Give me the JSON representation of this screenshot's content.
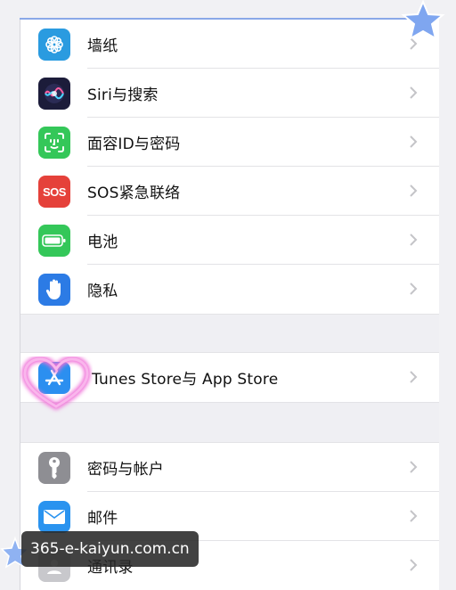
{
  "settings": {
    "group1": [
      {
        "label": "墙纸",
        "icon": "wallpaper-icon",
        "color": "#2a9be0"
      },
      {
        "label": "Siri与搜索",
        "icon": "siri-icon",
        "color": "#1c1c3a"
      },
      {
        "label": "面容ID与密码",
        "icon": "face-id-icon",
        "color": "#34c759"
      },
      {
        "label": "SOS紧急联络",
        "icon": "sos-icon",
        "color": "#e5413a"
      },
      {
        "label": "电池",
        "icon": "battery-icon",
        "color": "#34c759"
      },
      {
        "label": "隐私",
        "icon": "privacy-hand-icon",
        "color": "#2c7be5"
      }
    ],
    "group2": [
      {
        "label": "Tunes Store与 App Store",
        "icon": "app-store-icon",
        "color": "#2b8ff0"
      }
    ],
    "group3": [
      {
        "label": "密码与帐户",
        "icon": "key-icon",
        "color": "#8e8e93"
      },
      {
        "label": "邮件",
        "icon": "mail-icon",
        "color": "#2a93ef"
      },
      {
        "label": "通讯录",
        "icon": "contacts-icon",
        "color": "#c8c8cc"
      }
    ]
  },
  "watermark": {
    "text": "365-e-kaiyun.com.cn"
  }
}
